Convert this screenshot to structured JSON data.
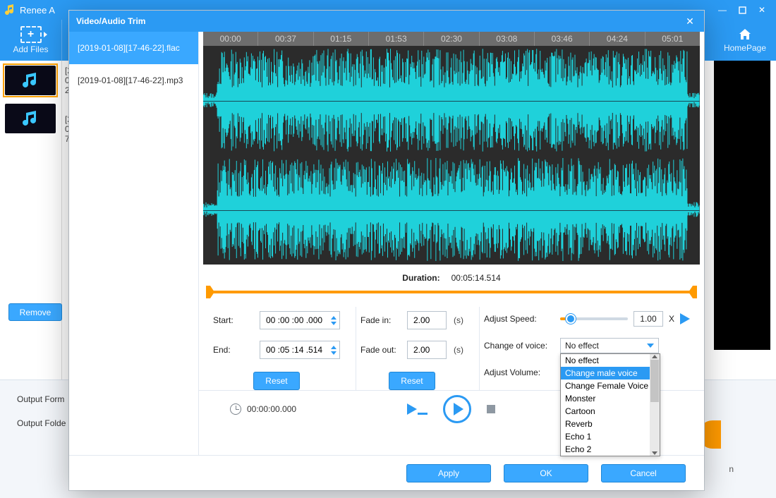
{
  "main_window": {
    "title": "Renee A",
    "toolbar": {
      "add_files": "Add Files",
      "homepage": "HomePage"
    },
    "file_list": {
      "item1_line1": "[2",
      "item1_line2": "0",
      "item1_line3": "2",
      "item2_line1": "[2",
      "item2_line2": "0",
      "item2_line3": "7"
    },
    "remove_btn": "Remove",
    "bottom": {
      "output_format": "Output Form",
      "output_folder": "Output Folde"
    }
  },
  "orange_n": "n",
  "modal": {
    "title": "Video/Audio Trim",
    "tracks": {
      "selected": "[2019-01-08][17-46-22].flac",
      "other": "[2019-01-08][17-46-22].mp3"
    },
    "ruler": [
      "00:00",
      "00:37",
      "01:15",
      "01:53",
      "02:30",
      "03:08",
      "03:46",
      "04:24",
      "05:01"
    ],
    "duration_label": "Duration:",
    "duration_value": "00:05:14.514",
    "start_label": "Start:",
    "start_value": "00 :00 :00 .000",
    "end_label": "End:",
    "end_value": "00 :05 :14 .514",
    "reset": "Reset",
    "fadein_label": "Fade in:",
    "fadein_value": "2.00",
    "fadeout_label": "Fade out:",
    "fadeout_value": "2.00",
    "sec_unit": "(s)",
    "speed_label": "Adjust Speed:",
    "speed_value": "1.00",
    "speed_x": "X",
    "voice_label": "Change of voice:",
    "voice_selected": "No effect",
    "voice_options": [
      "No effect",
      "Change male voice",
      "Change Female Voice",
      "Monster",
      "Cartoon",
      "Reverb",
      "Echo 1",
      "Echo 2"
    ],
    "voice_highlight_index": 1,
    "volume_label": "Adjust Volume:",
    "volume_unit": "%",
    "play_time": "00:00:00.000",
    "footer": {
      "apply": "Apply",
      "ok": "OK",
      "cancel": "Cancel"
    }
  }
}
